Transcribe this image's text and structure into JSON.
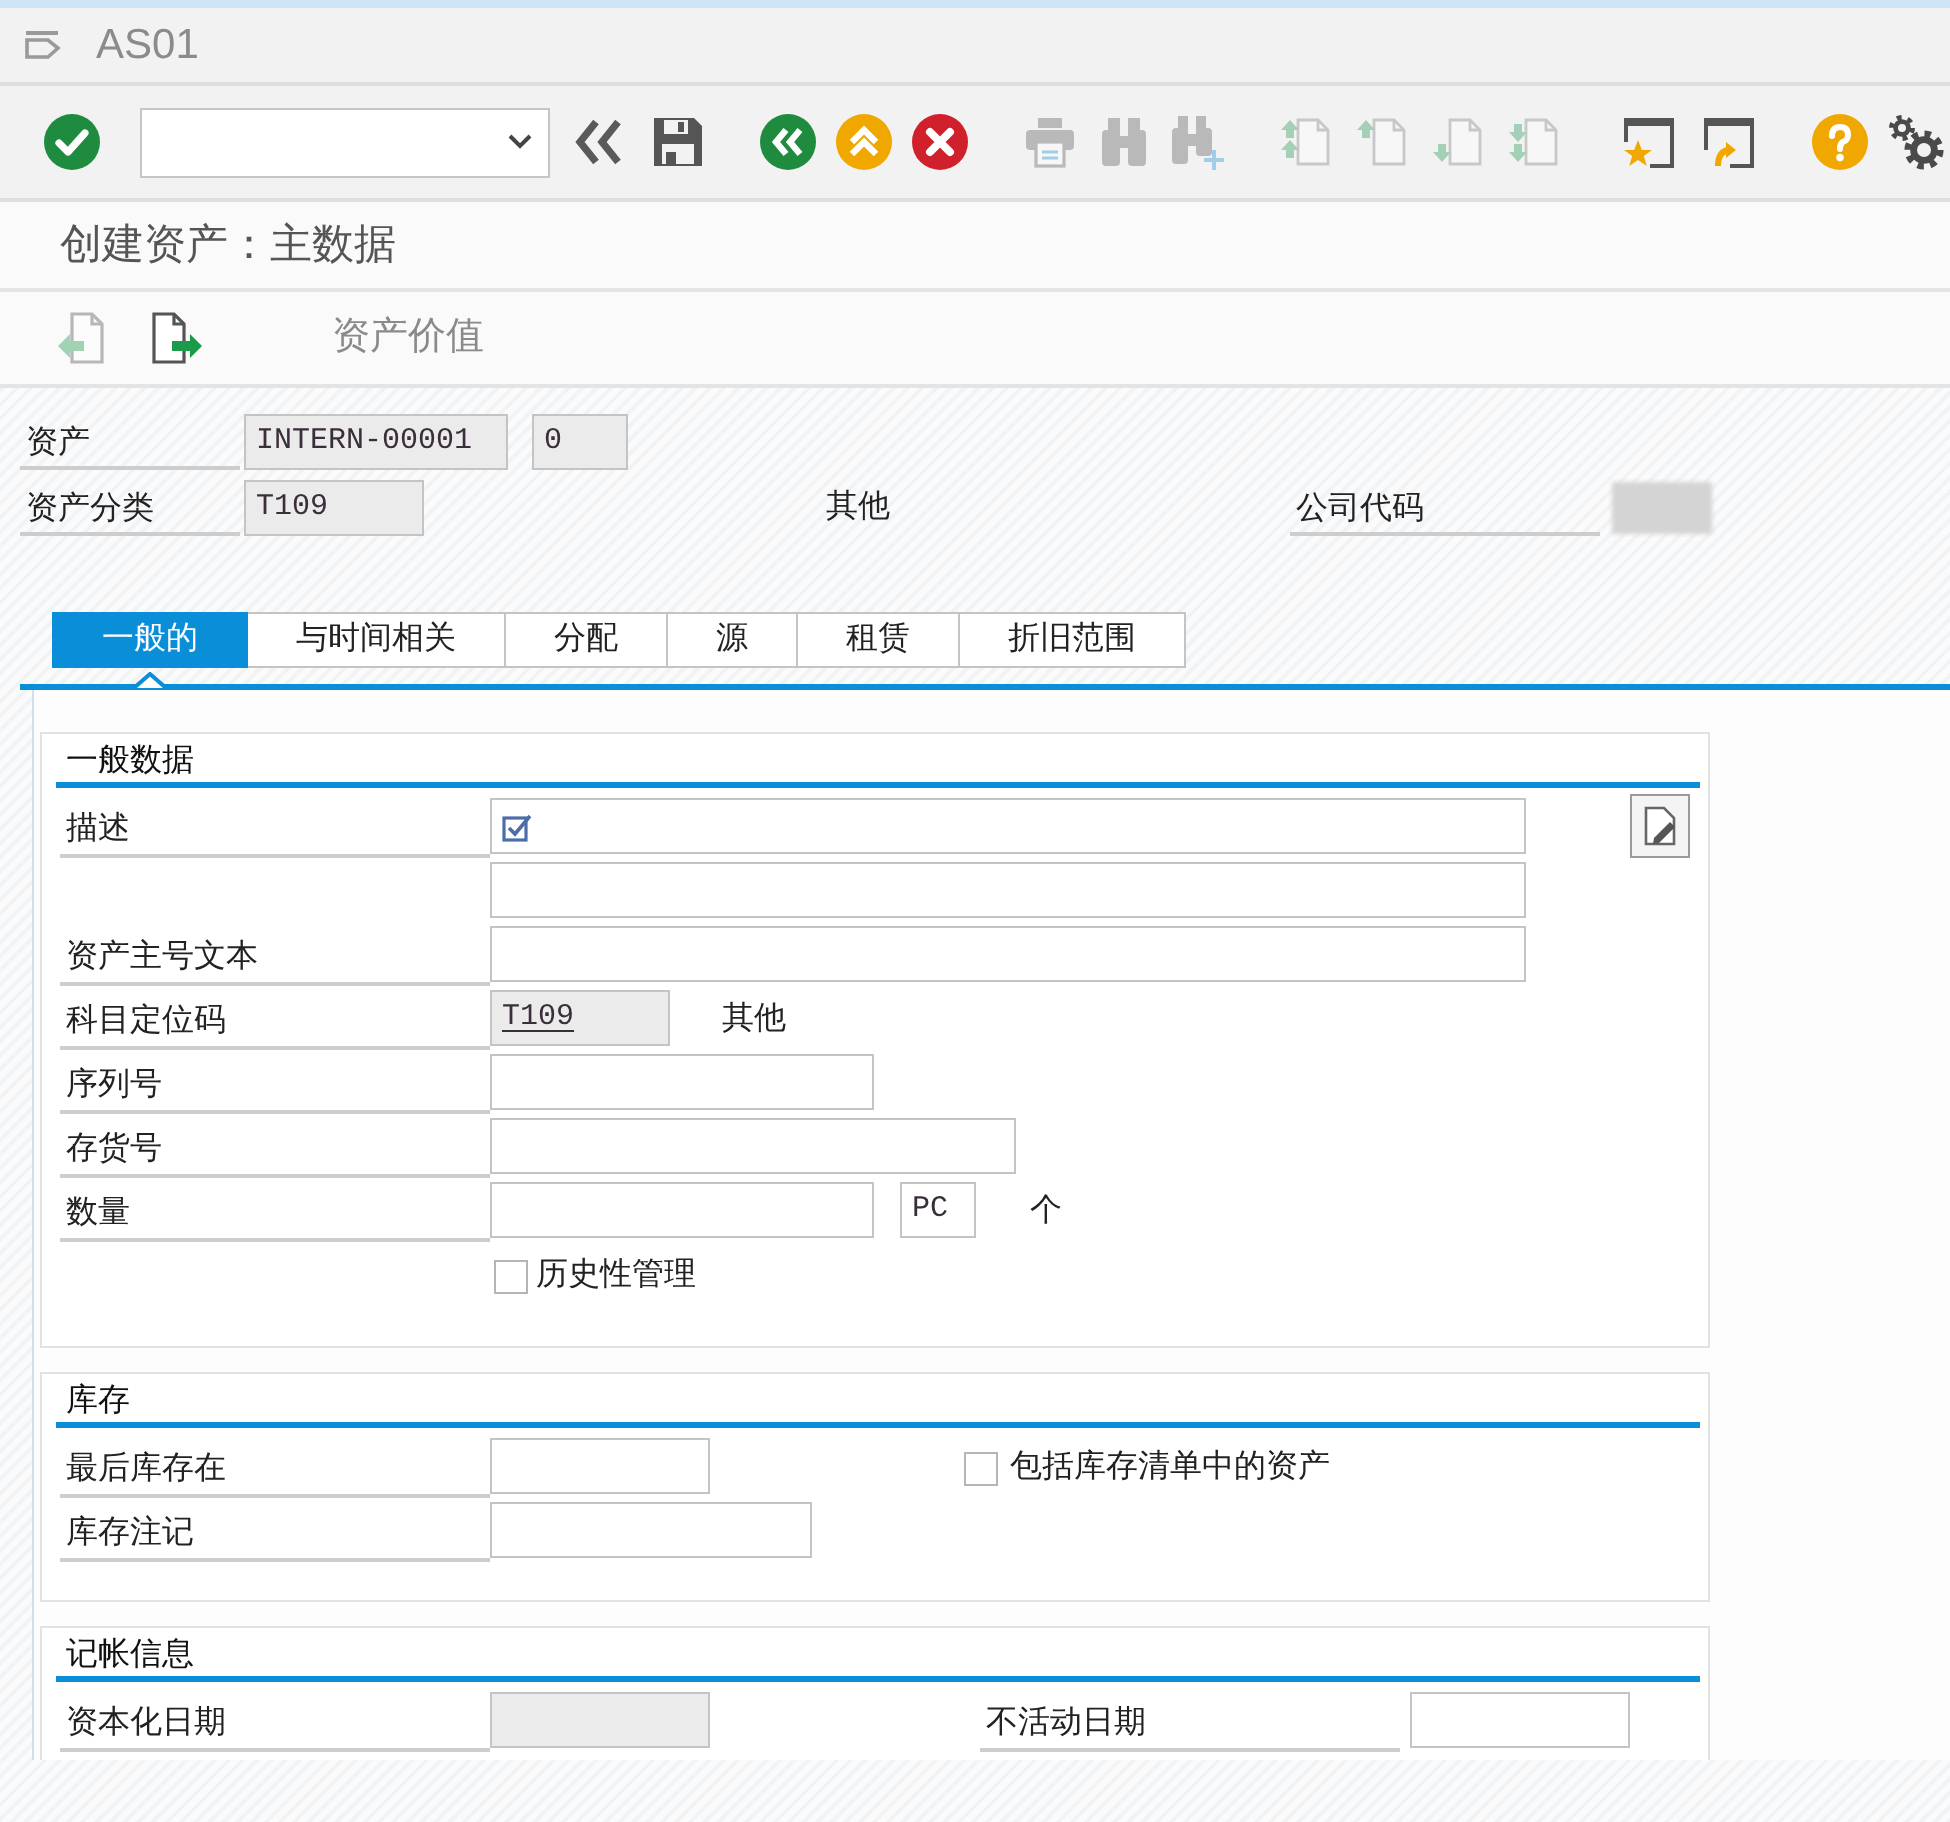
{
  "window": {
    "title": "AS01"
  },
  "toolbar": {
    "groups": [
      {
        "items": [
          {
            "kind": "enter",
            "disabled": false
          }
        ]
      },
      {
        "items": [
          {
            "kind": "command_field",
            "disabled": false
          },
          {
            "kind": "collapse",
            "disabled": false
          },
          {
            "kind": "save",
            "disabled": false
          }
        ]
      },
      {
        "items": [
          {
            "kind": "back",
            "disabled": false
          },
          {
            "kind": "exit",
            "disabled": false
          },
          {
            "kind": "cancel",
            "disabled": false
          }
        ]
      },
      {
        "items": [
          {
            "kind": "print",
            "disabled": true
          },
          {
            "kind": "find",
            "disabled": true
          },
          {
            "kind": "find_next",
            "disabled": true
          }
        ]
      },
      {
        "items": [
          {
            "kind": "first_page",
            "disabled": true
          },
          {
            "kind": "previous_page",
            "disabled": true
          },
          {
            "kind": "next_page",
            "disabled": true
          },
          {
            "kind": "last_page",
            "disabled": true
          }
        ]
      },
      {
        "items": [
          {
            "kind": "new_session",
            "disabled": false
          },
          {
            "kind": "shortcut",
            "disabled": false
          }
        ]
      },
      {
        "items": [
          {
            "kind": "help",
            "disabled": false
          },
          {
            "kind": "customize",
            "disabled": false
          }
        ]
      }
    ]
  },
  "screen_title": "创建资产：主数据",
  "app_toolbar": {
    "items": [
      {
        "kind": "previous_screen",
        "disabled": true
      },
      {
        "kind": "next_screen",
        "disabled": false
      },
      {
        "kind": "text",
        "label": "资产价值",
        "disabled": false
      }
    ]
  },
  "header": {
    "asset": {
      "label": "资产",
      "value": "INTERN-00001",
      "subnumber": "0",
      "readonly": true
    },
    "asset_class": {
      "label": "资产分类",
      "value": "T109",
      "description": "其他",
      "readonly": true
    },
    "company_code": {
      "label": "公司代码",
      "value_blurred": true
    }
  },
  "tabs": [
    {
      "label": "一般的",
      "selected": true
    },
    {
      "label": "与时间相关",
      "selected": false
    },
    {
      "label": "分配",
      "selected": false
    },
    {
      "label": "源",
      "selected": false
    },
    {
      "label": "租赁",
      "selected": false
    },
    {
      "label": "折旧范围",
      "selected": false
    }
  ],
  "general_data": {
    "title": "一般数据",
    "description": {
      "label": "描述",
      "required": true,
      "readonly": false
    },
    "asset_main_number_text": {
      "label": "资产主号文本",
      "readonly": false
    },
    "account_determination": {
      "label": "科目定位码",
      "value": "T109",
      "description": "其他",
      "readonly": true
    },
    "serial_number": {
      "label": "序列号",
      "readonly": false
    },
    "inventory_number": {
      "label": "存货号",
      "readonly": false
    },
    "quantity": {
      "label": "数量",
      "unit": "PC",
      "unit_text": "个",
      "readonly": false
    },
    "manage_historically": {
      "label": "历史性管理",
      "checked": false
    }
  },
  "inventory": {
    "title": "库存",
    "last_inventory_on": {
      "label": "最后库存在",
      "readonly": false
    },
    "include_in_inventory_list": {
      "label": "包括库存清单中的资产",
      "checked": false
    },
    "inventory_note": {
      "label": "库存注记",
      "readonly": false
    }
  },
  "posting_information": {
    "title": "记帐信息",
    "capitalized_on": {
      "label": "资本化日期",
      "readonly": true
    },
    "deactivation_on": {
      "label": "不活动日期",
      "readonly": false
    }
  }
}
